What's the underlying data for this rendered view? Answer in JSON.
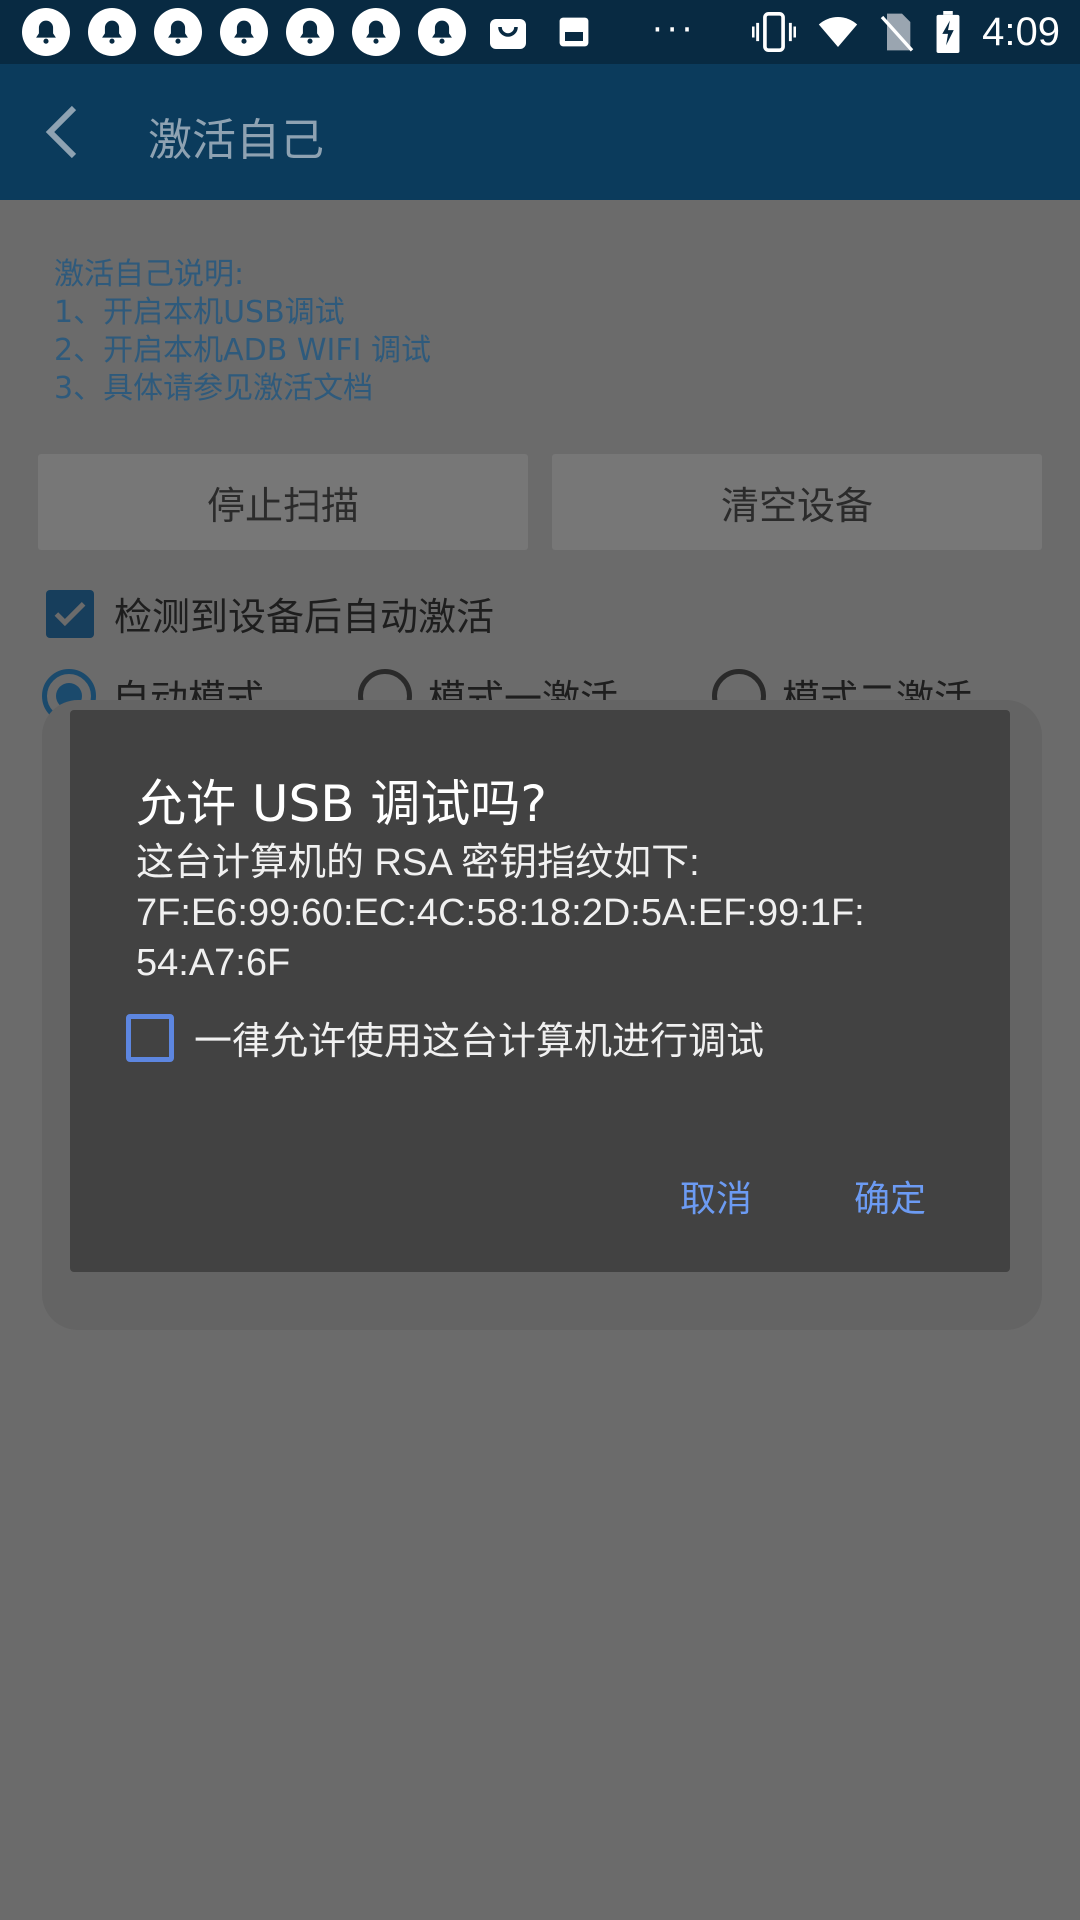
{
  "status_bar": {
    "time": "4:09",
    "notification_icons": [
      "bell-icon",
      "bell-icon",
      "bell-icon",
      "bell-icon",
      "bell-icon",
      "bell-icon",
      "bell-icon",
      "shopping-bag-icon",
      "store-icon"
    ],
    "more_dots": "···",
    "right_icons": [
      "vibrate-icon",
      "wifi-icon",
      "no-sim-icon",
      "battery-charging-icon"
    ]
  },
  "app_bar": {
    "title": "激活自己"
  },
  "instructions": {
    "heading": "激活自己说明:",
    "line1": "1、开启本机USB调试",
    "line2": "2、开启本机ADB WIFI 调试",
    "line3": "3、具体请参见激活文档"
  },
  "buttons": {
    "stop_scan": "停止扫描",
    "clear_devices": "清空设备"
  },
  "auto_activate": {
    "label": "检测到设备后自动激活",
    "checked": true
  },
  "modes": {
    "auto": "自动模式",
    "mode1": "模式一激活",
    "mode2": "模式二激活",
    "selected": "auto"
  },
  "dialog": {
    "title": "允许 USB 调试吗?",
    "message_line1": "这台计算机的 RSA 密钥指纹如下:",
    "message_line2": "7F:E6:99:60:EC:4C:58:18:2D:5A:EF:99:1F:",
    "message_line3": "54:A7:6F",
    "always_allow_label": "一律允许使用这台计算机进行调试",
    "always_allow_checked": false,
    "cancel_label": "取消",
    "ok_label": "确定",
    "accent_color": "#6c9bf3"
  }
}
